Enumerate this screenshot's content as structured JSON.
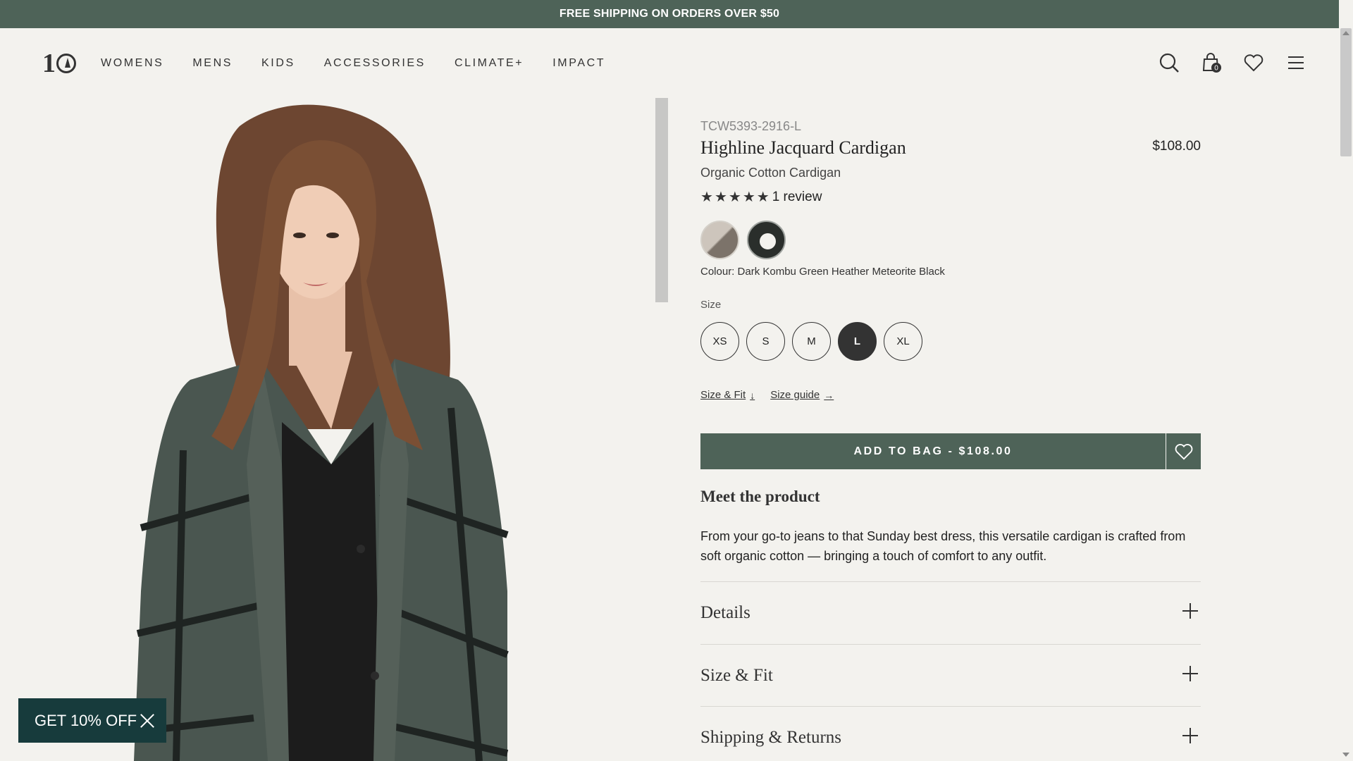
{
  "promo": {
    "text": "FREE SHIPPING ON ORDERS OVER $50"
  },
  "header": {
    "logo_text": "10",
    "nav": [
      {
        "label": "WOMENS"
      },
      {
        "label": "MENS"
      },
      {
        "label": "KIDS"
      },
      {
        "label": "ACCESSORIES"
      },
      {
        "label": "CLIMATE+"
      },
      {
        "label": "IMPACT"
      }
    ],
    "icons": [
      "search-icon",
      "bag-icon",
      "heart-icon",
      "menu-icon"
    ],
    "bag_count": "0"
  },
  "product": {
    "sku": "TCW5393-2916-L",
    "title": "Highline Jacquard Cardigan",
    "price": "$108.00",
    "subtitle": "Organic Cotton Cardigan",
    "rating": 5,
    "review_count": "1 review",
    "colour_text": "Colour: Dark Kombu Green Heather Meteorite Black",
    "size_label": "Size",
    "sizes": [
      "XS",
      "S",
      "M",
      "L",
      "XL"
    ],
    "selected_size": "L",
    "links": {
      "size_fit": "Size & Fit",
      "size_guide": "Size guide"
    },
    "add_to_bag": "ADD TO BAG - $108.00",
    "meet_heading": "Meet the product",
    "description": "From your go-to jeans to that Sunday best dress, this versatile cardigan is crafted from soft organic cotton — bringing a touch of comfort to any outfit.",
    "accordions": [
      {
        "title": "Details"
      },
      {
        "title": "Size & Fit"
      },
      {
        "title": "Shipping & Returns"
      }
    ]
  },
  "offer": {
    "text": "GET 10% OFF"
  },
  "colors": {
    "brand_green": "#4e6358",
    "offer_bg": "#173b3c",
    "page_bg": "#f3f2ee"
  }
}
